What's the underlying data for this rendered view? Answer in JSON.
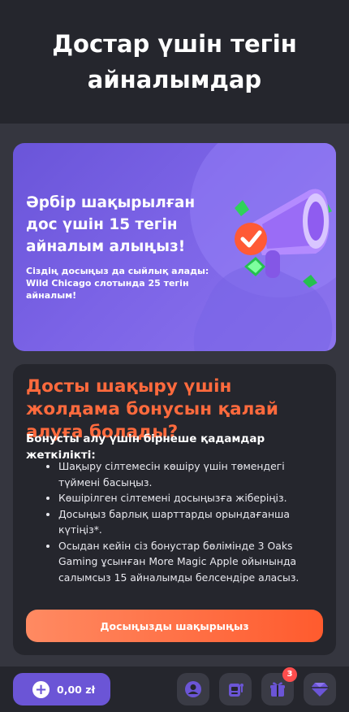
{
  "header": {
    "title": "Достар үшін тегін айналымдар"
  },
  "promo": {
    "title": "Әрбір шақырылған дос үшін 15 тегін айналым алыңыз!",
    "subtitle": "Сіздің досыңыз да сыйлық алады: Wild Chicago слотында 25 тегін айналым!",
    "image_icon": "megaphone-icon"
  },
  "card": {
    "title": "Досты шақыру үшін жолдама бонусын қалай алуға болады?",
    "subtitle": "Бонусты алу үшін бірнеше қадамдар жеткілікті:",
    "steps": [
      "Шақыру сілтемесін көшіру үшін төмендегі түймені басыңыз.",
      "Көшірілген сілтемені досыңызға жіберіңіз.",
      "Досыңыз барлық шарттарды орындағанша күтіңіз*.",
      "Осыдан кейін сіз бонустар бөлімінде 3 Oaks Gaming ұсынған More Magic Apple ойынында салымсыз 15 айналымды белсендіре аласыз."
    ],
    "cta_label": "Досыңызды шақырыңыз"
  },
  "bottom_bar": {
    "balance": "0,00 zł",
    "balance_icon": "plus-icon",
    "nav": [
      {
        "icon": "user-icon"
      },
      {
        "icon": "slot-machine-icon"
      },
      {
        "icon": "gift-icon",
        "badge": "3"
      },
      {
        "icon": "diamond-icon"
      }
    ]
  },
  "colors": {
    "accent_orange": "#ff6a3d",
    "purple": "#6b55d6",
    "background": "#35363f",
    "panel": "#25262d"
  }
}
